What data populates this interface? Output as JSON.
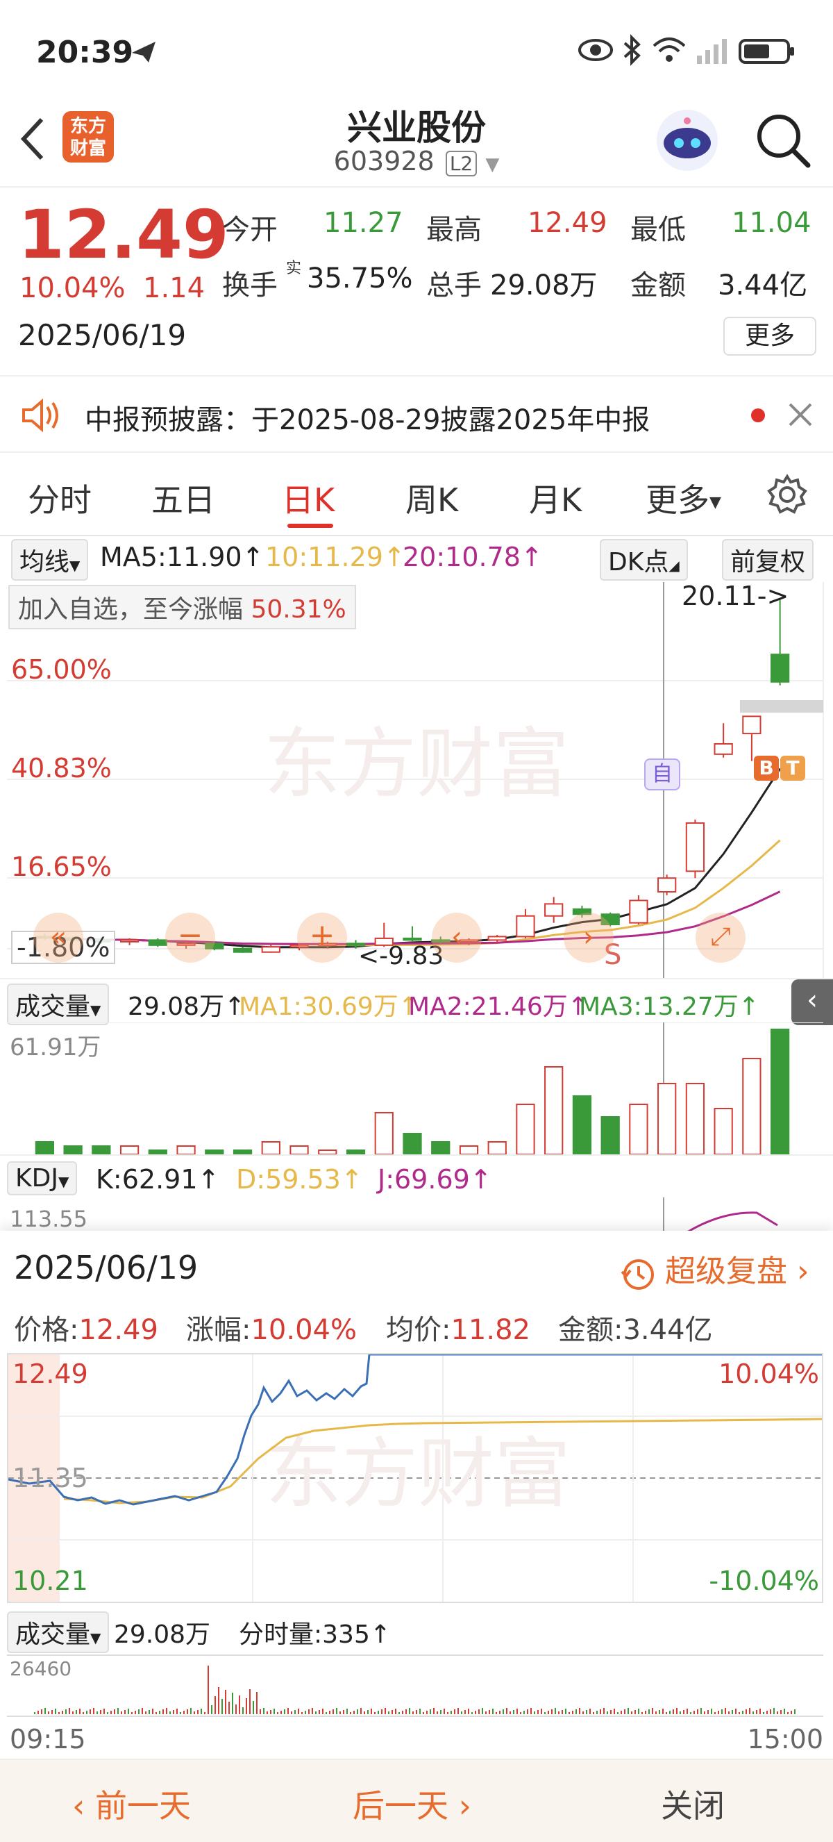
{
  "status": {
    "time": "20:39"
  },
  "header": {
    "title": "兴业股份",
    "code": "603928",
    "badge": "L2",
    "logo_line1": "东方",
    "logo_line2": "财富"
  },
  "quote": {
    "price": "12.49",
    "change_pct": "10.04%",
    "change": "1.14",
    "date": "2025/06/19",
    "open_label": "今开",
    "open": "11.27",
    "high_label": "最高",
    "high": "12.49",
    "low_label": "最低",
    "low": "11.04",
    "turnover_label": "换手",
    "turnover_sup": "实",
    "turnover": "35.75%",
    "volume_label": "总手",
    "volume": "29.08万",
    "amount_label": "金额",
    "amount": "3.44亿",
    "more_label": "更多"
  },
  "notice": {
    "text": "中报预披露：于2025-08-29披露2025年中报"
  },
  "tabs": [
    "分时",
    "五日",
    "日K",
    "周K",
    "月K",
    "更多"
  ],
  "active_tab": 2,
  "kline": {
    "ma_select": "均线",
    "ma5": "MA5:11.90↑",
    "ma10": "10:11.29↑",
    "ma20": "20:10.78↑",
    "dk_label": "DK点",
    "fq_label": "前复权",
    "watch_text": "加入自选，至今涨幅",
    "watch_pct": "50.31%",
    "high_marker": "20.11->",
    "low_marker": "<-9.83",
    "y_labels": [
      "65.00%",
      "40.83%",
      "16.65%",
      "-1.80%"
    ],
    "watermark": "东方财富",
    "mark_zi": "自",
    "mark_b": "B",
    "mark_t": "T",
    "mark_s": "S"
  },
  "volume": {
    "select": "成交量",
    "vol": "29.08万↑",
    "ma1": "MA1:30.69万↑",
    "ma2": "MA2:21.46万↑",
    "ma3": "MA3:13.27万↑",
    "max": "61.91万"
  },
  "kdj": {
    "select": "KDJ",
    "k": "K:62.91↑",
    "d": "D:59.53↑",
    "j": "J:69.69↑",
    "max": "113.55"
  },
  "review": {
    "date": "2025/06/19",
    "link": "超级复盘",
    "price_label": "价格:",
    "price": "12.49",
    "pct_label": "涨幅:",
    "pct": "10.04%",
    "avg_label": "均价:",
    "avg": "11.82",
    "amount_label": "金额:",
    "amount": "3.44亿",
    "y_top": "12.49",
    "y_mid": "11.35",
    "y_bot": "10.21",
    "pct_top": "10.04%",
    "pct_bot": "-10.04%",
    "vol_select": "成交量",
    "vol": "29.08万",
    "tick_vol": "分时量:335↑",
    "vol_max": "26460",
    "t_start": "09:15",
    "t_end": "15:00"
  },
  "bottom": {
    "prev": "前一天",
    "next": "后一天",
    "close": "关闭"
  },
  "colors": {
    "up": "#d43c33",
    "down": "#3a9a3a",
    "ma5": "#222222",
    "ma10": "#e6b84a",
    "ma20": "#b02a8c",
    "accent": "#e66b2c"
  },
  "chart_data": {
    "type": "candlestick",
    "candles": [
      {
        "o": 10.3,
        "h": 10.4,
        "l": 10.2,
        "c": 10.28
      },
      {
        "o": 10.25,
        "h": 10.3,
        "l": 10.15,
        "c": 10.2
      },
      {
        "o": 10.2,
        "h": 10.3,
        "l": 10.1,
        "c": 10.15
      },
      {
        "o": 10.15,
        "h": 10.25,
        "l": 10.05,
        "c": 10.2
      },
      {
        "o": 10.2,
        "h": 10.25,
        "l": 10.0,
        "c": 10.05
      },
      {
        "o": 10.05,
        "h": 10.15,
        "l": 9.95,
        "c": 10.1
      },
      {
        "o": 10.1,
        "h": 10.15,
        "l": 9.9,
        "c": 9.95
      },
      {
        "o": 9.95,
        "h": 10.0,
        "l": 9.83,
        "c": 9.85
      },
      {
        "o": 9.85,
        "h": 10.1,
        "l": 9.83,
        "c": 10.0
      },
      {
        "o": 10.0,
        "h": 10.1,
        "l": 9.9,
        "c": 10.05
      },
      {
        "o": 10.05,
        "h": 10.15,
        "l": 9.95,
        "c": 10.1
      },
      {
        "o": 10.1,
        "h": 10.2,
        "l": 9.95,
        "c": 10.05
      },
      {
        "o": 10.05,
        "h": 10.7,
        "l": 10.0,
        "c": 10.25
      },
      {
        "o": 10.25,
        "h": 10.6,
        "l": 10.15,
        "c": 10.2
      },
      {
        "o": 10.2,
        "h": 10.3,
        "l": 10.1,
        "c": 10.15
      },
      {
        "o": 10.15,
        "h": 10.25,
        "l": 10.05,
        "c": 10.2
      },
      {
        "o": 10.2,
        "h": 10.35,
        "l": 10.1,
        "c": 10.3
      },
      {
        "o": 10.3,
        "h": 11.1,
        "l": 10.25,
        "c": 10.9
      },
      {
        "o": 10.9,
        "h": 11.45,
        "l": 10.7,
        "c": 11.25
      },
      {
        "o": 11.1,
        "h": 11.2,
        "l": 10.85,
        "c": 10.95
      },
      {
        "o": 10.95,
        "h": 11.0,
        "l": 10.6,
        "c": 10.65
      },
      {
        "o": 10.7,
        "h": 11.5,
        "l": 10.65,
        "c": 11.35
      },
      {
        "o": 11.6,
        "h": 12.1,
        "l": 11.5,
        "c": 12.0
      },
      {
        "o": 12.2,
        "h": 13.7,
        "l": 12.0,
        "c": 13.6
      },
      {
        "o": 15.6,
        "h": 16.5,
        "l": 15.5,
        "c": 15.9
      },
      {
        "o": 16.2,
        "h": 16.7,
        "l": 15.4,
        "c": 16.7
      },
      {
        "o": 18.5,
        "h": 20.11,
        "l": 17.6,
        "c": 17.7
      }
    ],
    "volumes": [
      3,
      2,
      2,
      2,
      1,
      2,
      1,
      1,
      3,
      2,
      1,
      1,
      10,
      5,
      3,
      2,
      3,
      12,
      21,
      14,
      9,
      12,
      17,
      17,
      11,
      23,
      30
    ],
    "vol_max": 30
  }
}
